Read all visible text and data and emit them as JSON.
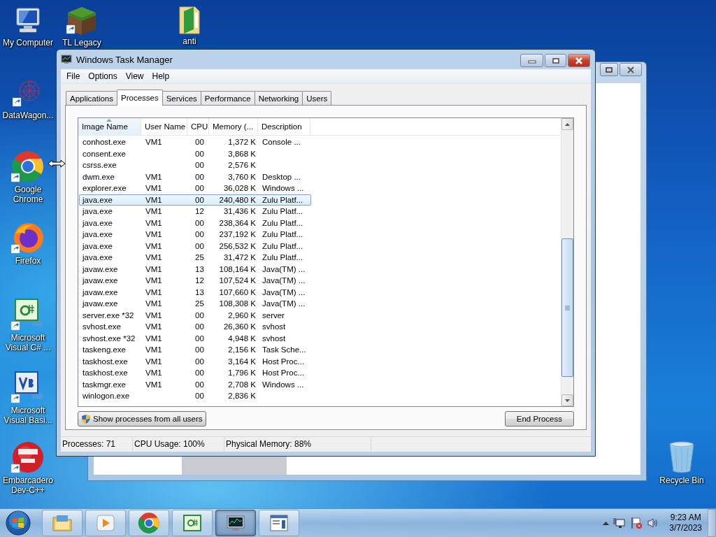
{
  "desktop_icons": [
    {
      "label": "My Computer"
    },
    {
      "label": "TL Legacy"
    },
    {
      "label": "anti"
    },
    {
      "label": "DataWagon..."
    },
    {
      "label": "Google Chrome"
    },
    {
      "label": "Firefox"
    },
    {
      "label": "Microsoft Visual C# ..."
    },
    {
      "label": "Microsoft Visual Basi..."
    },
    {
      "label": "Embarcadero Dev-C++"
    },
    {
      "label": "Recycle Bin"
    }
  ],
  "task_manager": {
    "title": "Windows Task Manager",
    "menu": [
      "File",
      "Options",
      "View",
      "Help"
    ],
    "tabs": [
      {
        "label": "Applications",
        "selected": false
      },
      {
        "label": "Processes",
        "selected": true
      },
      {
        "label": "Services",
        "selected": false
      },
      {
        "label": "Performance",
        "selected": false
      },
      {
        "label": "Networking",
        "selected": false
      },
      {
        "label": "Users",
        "selected": false
      }
    ],
    "columns": [
      "Image Name",
      "User Name",
      "CPU",
      "Memory (...",
      "Description"
    ],
    "rows": [
      {
        "cells": [
          "conhost.exe",
          "VM1",
          "00",
          "1,372 K",
          "Console ..."
        ],
        "selected": false
      },
      {
        "cells": [
          "consent.exe",
          "",
          "00",
          "3,868 K",
          ""
        ],
        "selected": false
      },
      {
        "cells": [
          "csrss.exe",
          "",
          "00",
          "2,576 K",
          ""
        ],
        "selected": false
      },
      {
        "cells": [
          "dwm.exe",
          "VM1",
          "00",
          "3,760 K",
          "Desktop ..."
        ],
        "selected": false
      },
      {
        "cells": [
          "explorer.exe",
          "VM1",
          "00",
          "36,028 K",
          "Windows ..."
        ],
        "selected": false
      },
      {
        "cells": [
          "java.exe",
          "VM1",
          "00",
          "240,480 K",
          "Zulu Platf..."
        ],
        "selected": true
      },
      {
        "cells": [
          "java.exe",
          "VM1",
          "12",
          "31,436 K",
          "Zulu Platf..."
        ],
        "selected": false
      },
      {
        "cells": [
          "java.exe",
          "VM1",
          "00",
          "238,364 K",
          "Zulu Platf..."
        ],
        "selected": false
      },
      {
        "cells": [
          "java.exe",
          "VM1",
          "00",
          "237,192 K",
          "Zulu Platf..."
        ],
        "selected": false
      },
      {
        "cells": [
          "java.exe",
          "VM1",
          "00",
          "256,532 K",
          "Zulu Platf..."
        ],
        "selected": false
      },
      {
        "cells": [
          "java.exe",
          "VM1",
          "25",
          "31,472 K",
          "Zulu Platf..."
        ],
        "selected": false
      },
      {
        "cells": [
          "javaw.exe",
          "VM1",
          "13",
          "108,164 K",
          "Java(TM) ..."
        ],
        "selected": false
      },
      {
        "cells": [
          "javaw.exe",
          "VM1",
          "12",
          "107,524 K",
          "Java(TM) ..."
        ],
        "selected": false
      },
      {
        "cells": [
          "javaw.exe",
          "VM1",
          "13",
          "107,660 K",
          "Java(TM) ..."
        ],
        "selected": false
      },
      {
        "cells": [
          "javaw.exe",
          "VM1",
          "25",
          "108,308 K",
          "Java(TM) ..."
        ],
        "selected": false
      },
      {
        "cells": [
          "server.exe *32",
          "VM1",
          "00",
          "2,960 K",
          "server"
        ],
        "selected": false
      },
      {
        "cells": [
          "svhost.exe",
          "VM1",
          "00",
          "26,360 K",
          "svhost"
        ],
        "selected": false
      },
      {
        "cells": [
          "svhost.exe *32",
          "VM1",
          "00",
          "4,948 K",
          "svhost"
        ],
        "selected": false
      },
      {
        "cells": [
          "taskeng.exe",
          "VM1",
          "00",
          "2,156 K",
          "Task Sche..."
        ],
        "selected": false
      },
      {
        "cells": [
          "taskhost.exe",
          "VM1",
          "00",
          "3,164 K",
          "Host Proc..."
        ],
        "selected": false
      },
      {
        "cells": [
          "taskhost.exe",
          "VM1",
          "00",
          "1,796 K",
          "Host Proc..."
        ],
        "selected": false
      },
      {
        "cells": [
          "taskmgr.exe",
          "VM1",
          "00",
          "2,708 K",
          "Windows ..."
        ],
        "selected": false
      },
      {
        "cells": [
          "winlogon.exe",
          "",
          "00",
          "2,836 K",
          ""
        ],
        "selected": false
      }
    ],
    "show_all_button": "Show processes from all users",
    "end_process_button": "End Process",
    "status_bar": [
      "Processes: 71",
      "CPU Usage: 100%",
      "Physical Memory: 88%"
    ]
  },
  "taskbar": {
    "apps": [
      {
        "active": false
      },
      {
        "active": false
      },
      {
        "active": false
      },
      {
        "active": false
      },
      {
        "active": true
      },
      {
        "active": false
      }
    ],
    "clock": {
      "time": "9:23 AM",
      "date": "3/7/2023"
    }
  }
}
